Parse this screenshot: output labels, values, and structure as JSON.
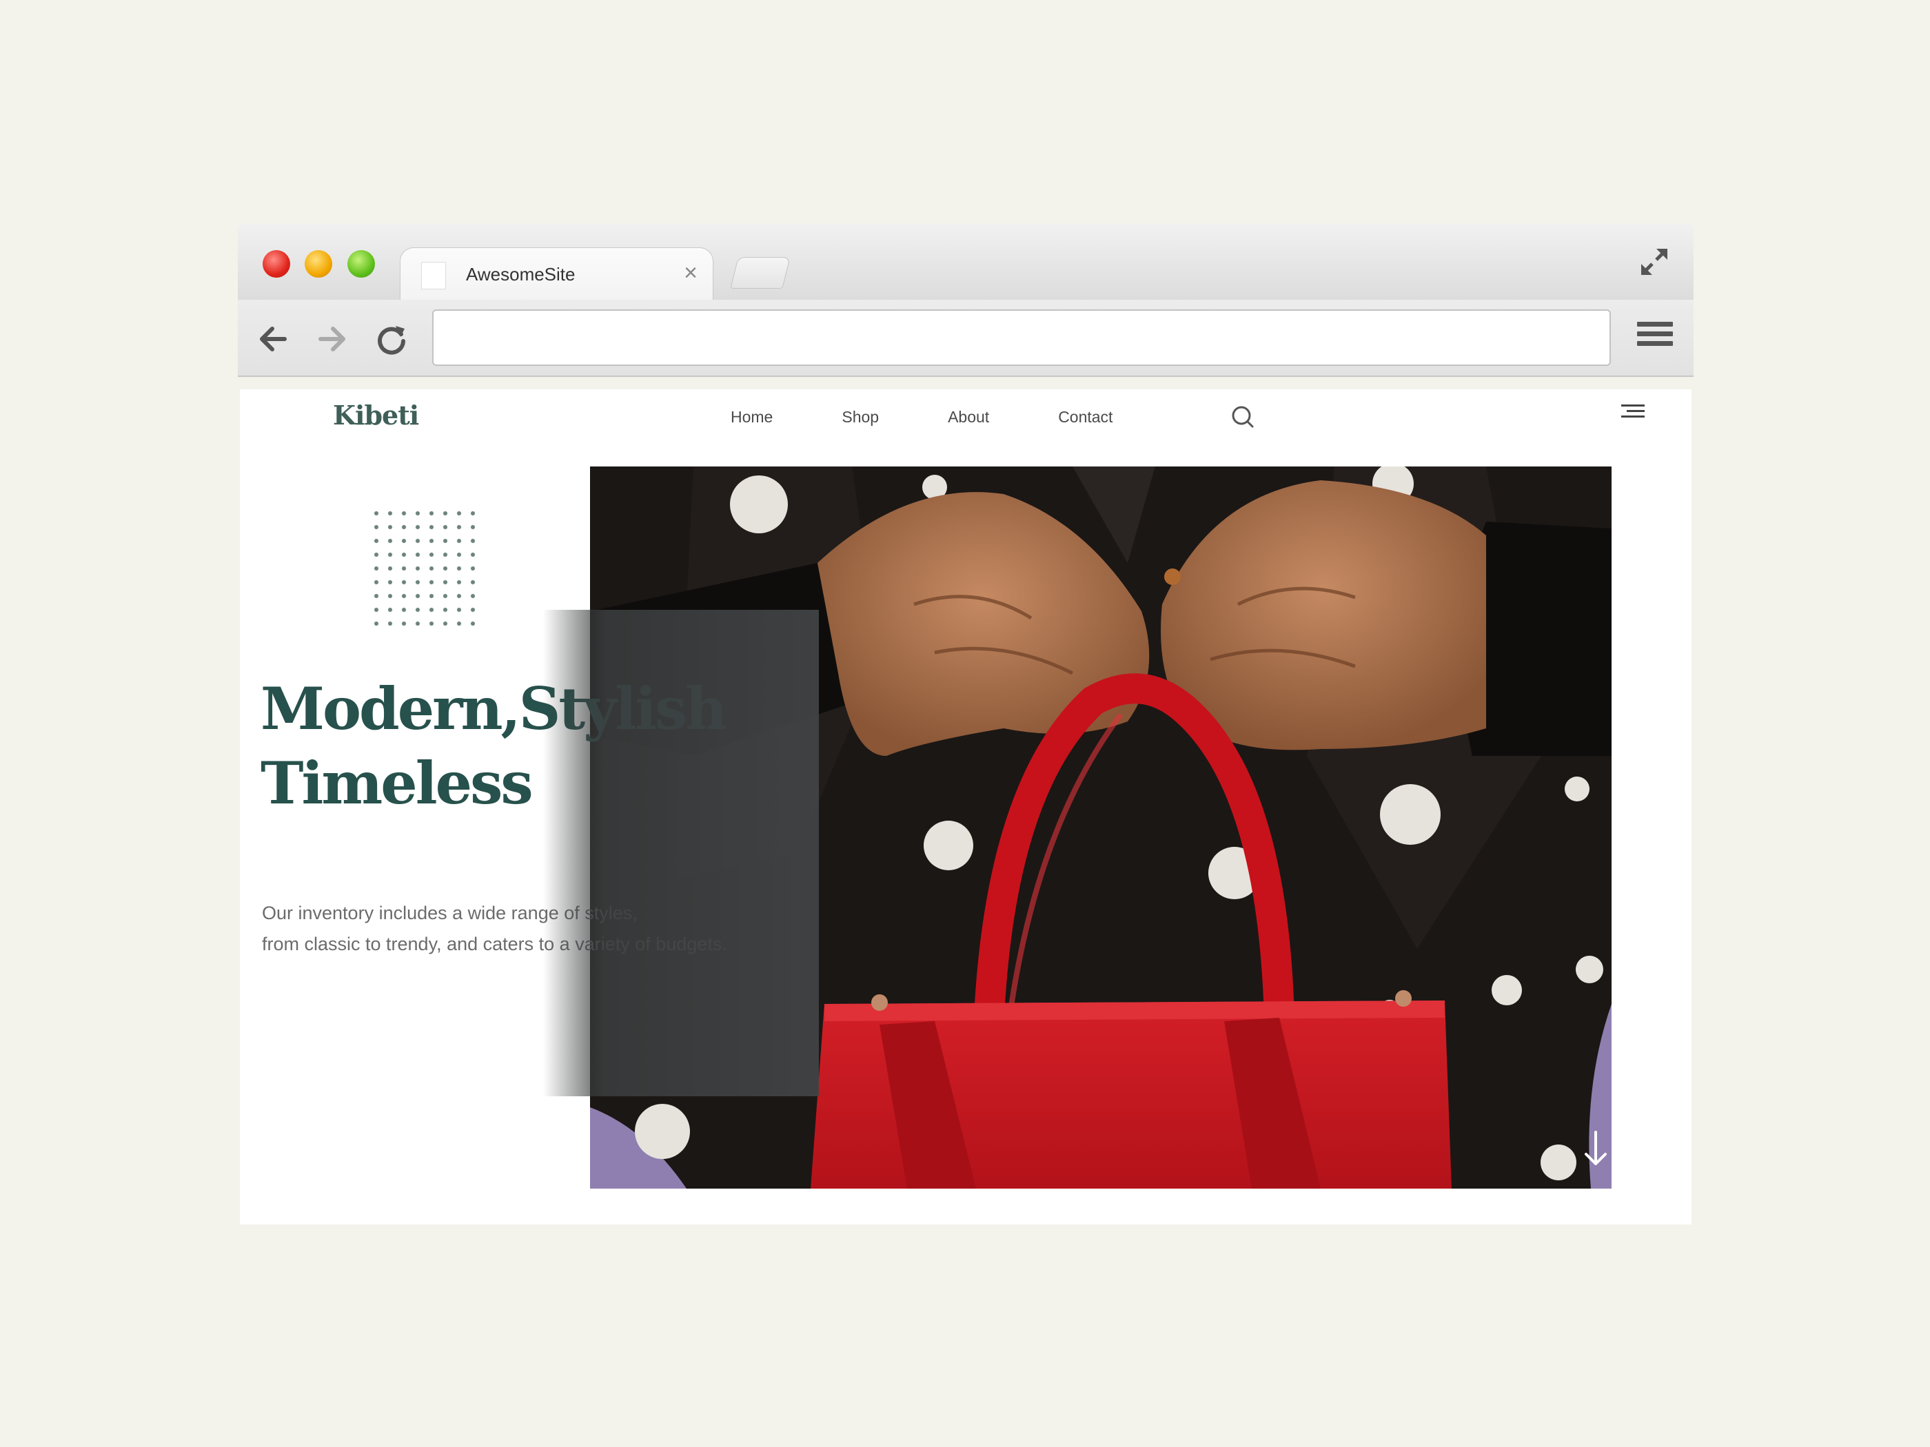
{
  "browser": {
    "tab_title": "AwesomeSite",
    "tab_close": "×",
    "url": ""
  },
  "site": {
    "logo": "Kibeti",
    "nav": [
      "Home",
      "Shop",
      "About",
      "Contact"
    ],
    "headline_line1": "Modern,Stylish",
    "headline_line2": "Timeless",
    "description_line1": "Our inventory includes a wide range of styles,",
    "description_line2": "from classic to trendy, and caters to a variety of budgets."
  },
  "colors": {
    "background": "#f3f3ec",
    "brand_green": "#27514c",
    "bag_red": "#c9161e",
    "blouse_black": "#1a1614"
  },
  "icons": {
    "search": "search-icon",
    "menu": "hamburger-icon",
    "scroll": "arrow-down-icon"
  }
}
